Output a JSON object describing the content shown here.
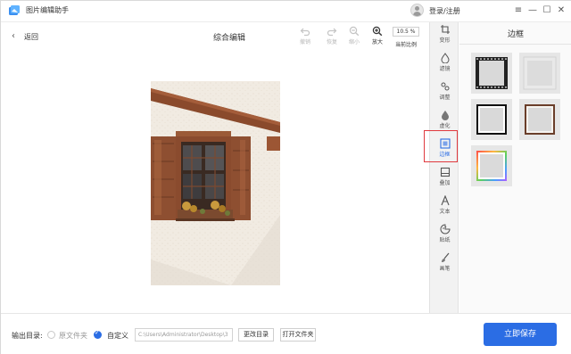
{
  "app": {
    "title": "图片编辑助手",
    "login": "登录/注册"
  },
  "window_controls": {
    "menu": "≡",
    "minimize": "—",
    "maximize": "☐",
    "close": "✕"
  },
  "toolbar": {
    "back": "返回",
    "title": "综合编辑",
    "undo": "撤销",
    "redo": "恢复",
    "zoom_out": "缩小",
    "zoom_in": "放大",
    "zoom_value": "10.5 %",
    "zoom_label": "当前比例"
  },
  "side_tools": [
    {
      "label": "变形",
      "icon": "crop-icon"
    },
    {
      "label": "滤镜",
      "icon": "filter-icon"
    },
    {
      "label": "调整",
      "icon": "adjust-icon"
    },
    {
      "label": "虚化",
      "icon": "blur-icon"
    },
    {
      "label": "边框",
      "icon": "frame-icon"
    },
    {
      "label": "叠加",
      "icon": "overlay-icon"
    },
    {
      "label": "文本",
      "icon": "text-icon"
    },
    {
      "label": "贴纸",
      "icon": "sticker-icon"
    },
    {
      "label": "画笔",
      "icon": "brush-icon"
    }
  ],
  "active_side_tool": "边框",
  "panel": {
    "title": "边框"
  },
  "bottom": {
    "output_label": "输出目录:",
    "option_original": "原文件夹",
    "option_custom": "自定义",
    "path_value": "C:\\Users\\Administrator\\Desktop\\3",
    "change_dir": "更改目录",
    "open_folder": "打开文件夹",
    "save": "立即保存"
  },
  "colors": {
    "accent": "#2b6de4",
    "selection_outline": "#e0393e"
  }
}
